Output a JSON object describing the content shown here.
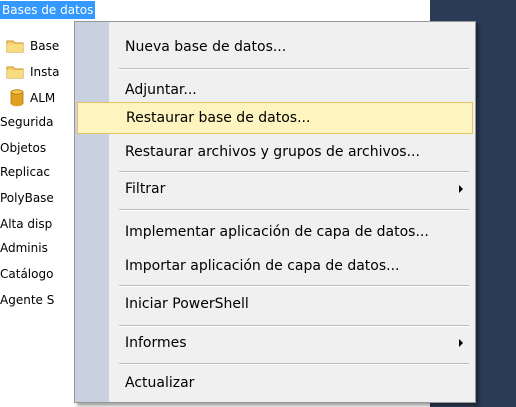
{
  "tree": {
    "root_label": "Bases de datos",
    "children": [
      {
        "label": "Base",
        "icon": "folder-icon"
      },
      {
        "label": "Insta",
        "icon": "folder-icon"
      },
      {
        "label": "ALM",
        "icon": "database-icon"
      }
    ],
    "siblings": [
      "Segurida",
      "Objetos",
      "Replicac",
      "PolyBase",
      "Alta disp",
      "Adminis",
      "Catálogo",
      "Agente S"
    ]
  },
  "context_menu": {
    "items": [
      {
        "label": "Nueva base de datos..."
      },
      {
        "label": "Adjuntar..."
      },
      {
        "label": "Restaurar base de datos...",
        "highlighted": true
      },
      {
        "label": "Restaurar archivos y grupos de archivos..."
      },
      {
        "label": "Filtrar",
        "has_submenu": true
      },
      {
        "label": "Implementar aplicación de capa de datos..."
      },
      {
        "label": "Importar aplicación de capa de datos..."
      },
      {
        "label": "Iniciar PowerShell"
      },
      {
        "label": "Informes",
        "has_submenu": true
      },
      {
        "label": "Actualizar"
      }
    ]
  },
  "colors": {
    "selection": "#3399ff",
    "menu_background": "#f0f0f0",
    "menu_gutter": "#c9d0e0",
    "highlight_background": "#fdf4bf",
    "highlight_border": "#e5c365",
    "dark_panel": "#2b3a55"
  }
}
